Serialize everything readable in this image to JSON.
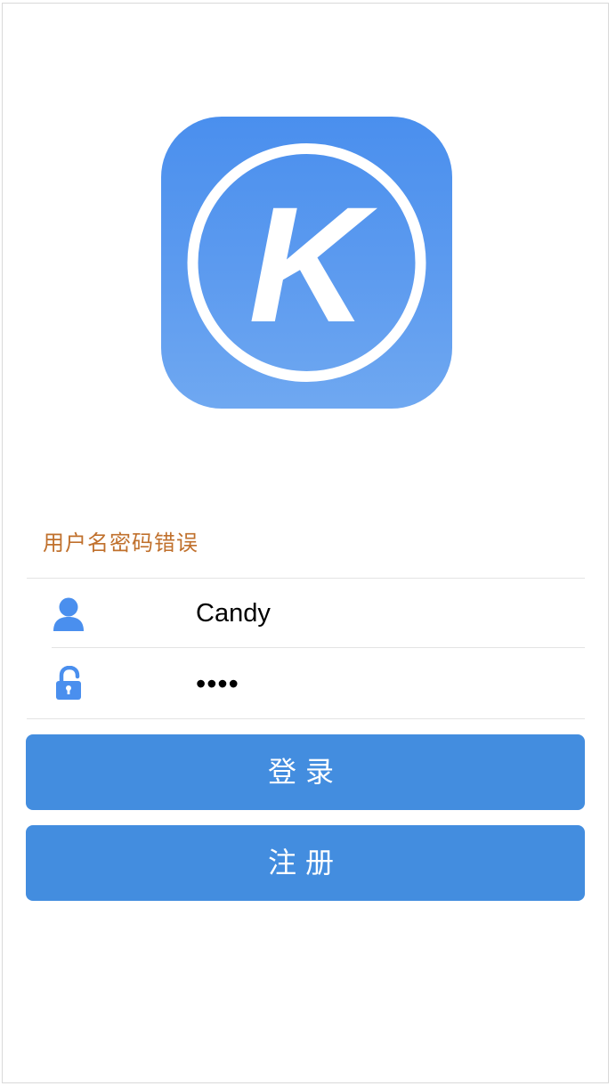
{
  "app": {
    "logo_letter": "K",
    "accent_color": "#438ddf",
    "logo_gradient": [
      "#4a8fee",
      "#6fa8f1"
    ]
  },
  "login": {
    "error_message": "用户名密码错误",
    "username": {
      "icon": "user-icon",
      "value": "Candy"
    },
    "password": {
      "icon": "unlocked-padlock-icon",
      "masked_value": "••••"
    },
    "login_button": "登录",
    "register_button": "注册"
  },
  "colors": {
    "error_text": "#c0702c",
    "divider": "#e3e3e3",
    "icon": "#4a8fee"
  }
}
